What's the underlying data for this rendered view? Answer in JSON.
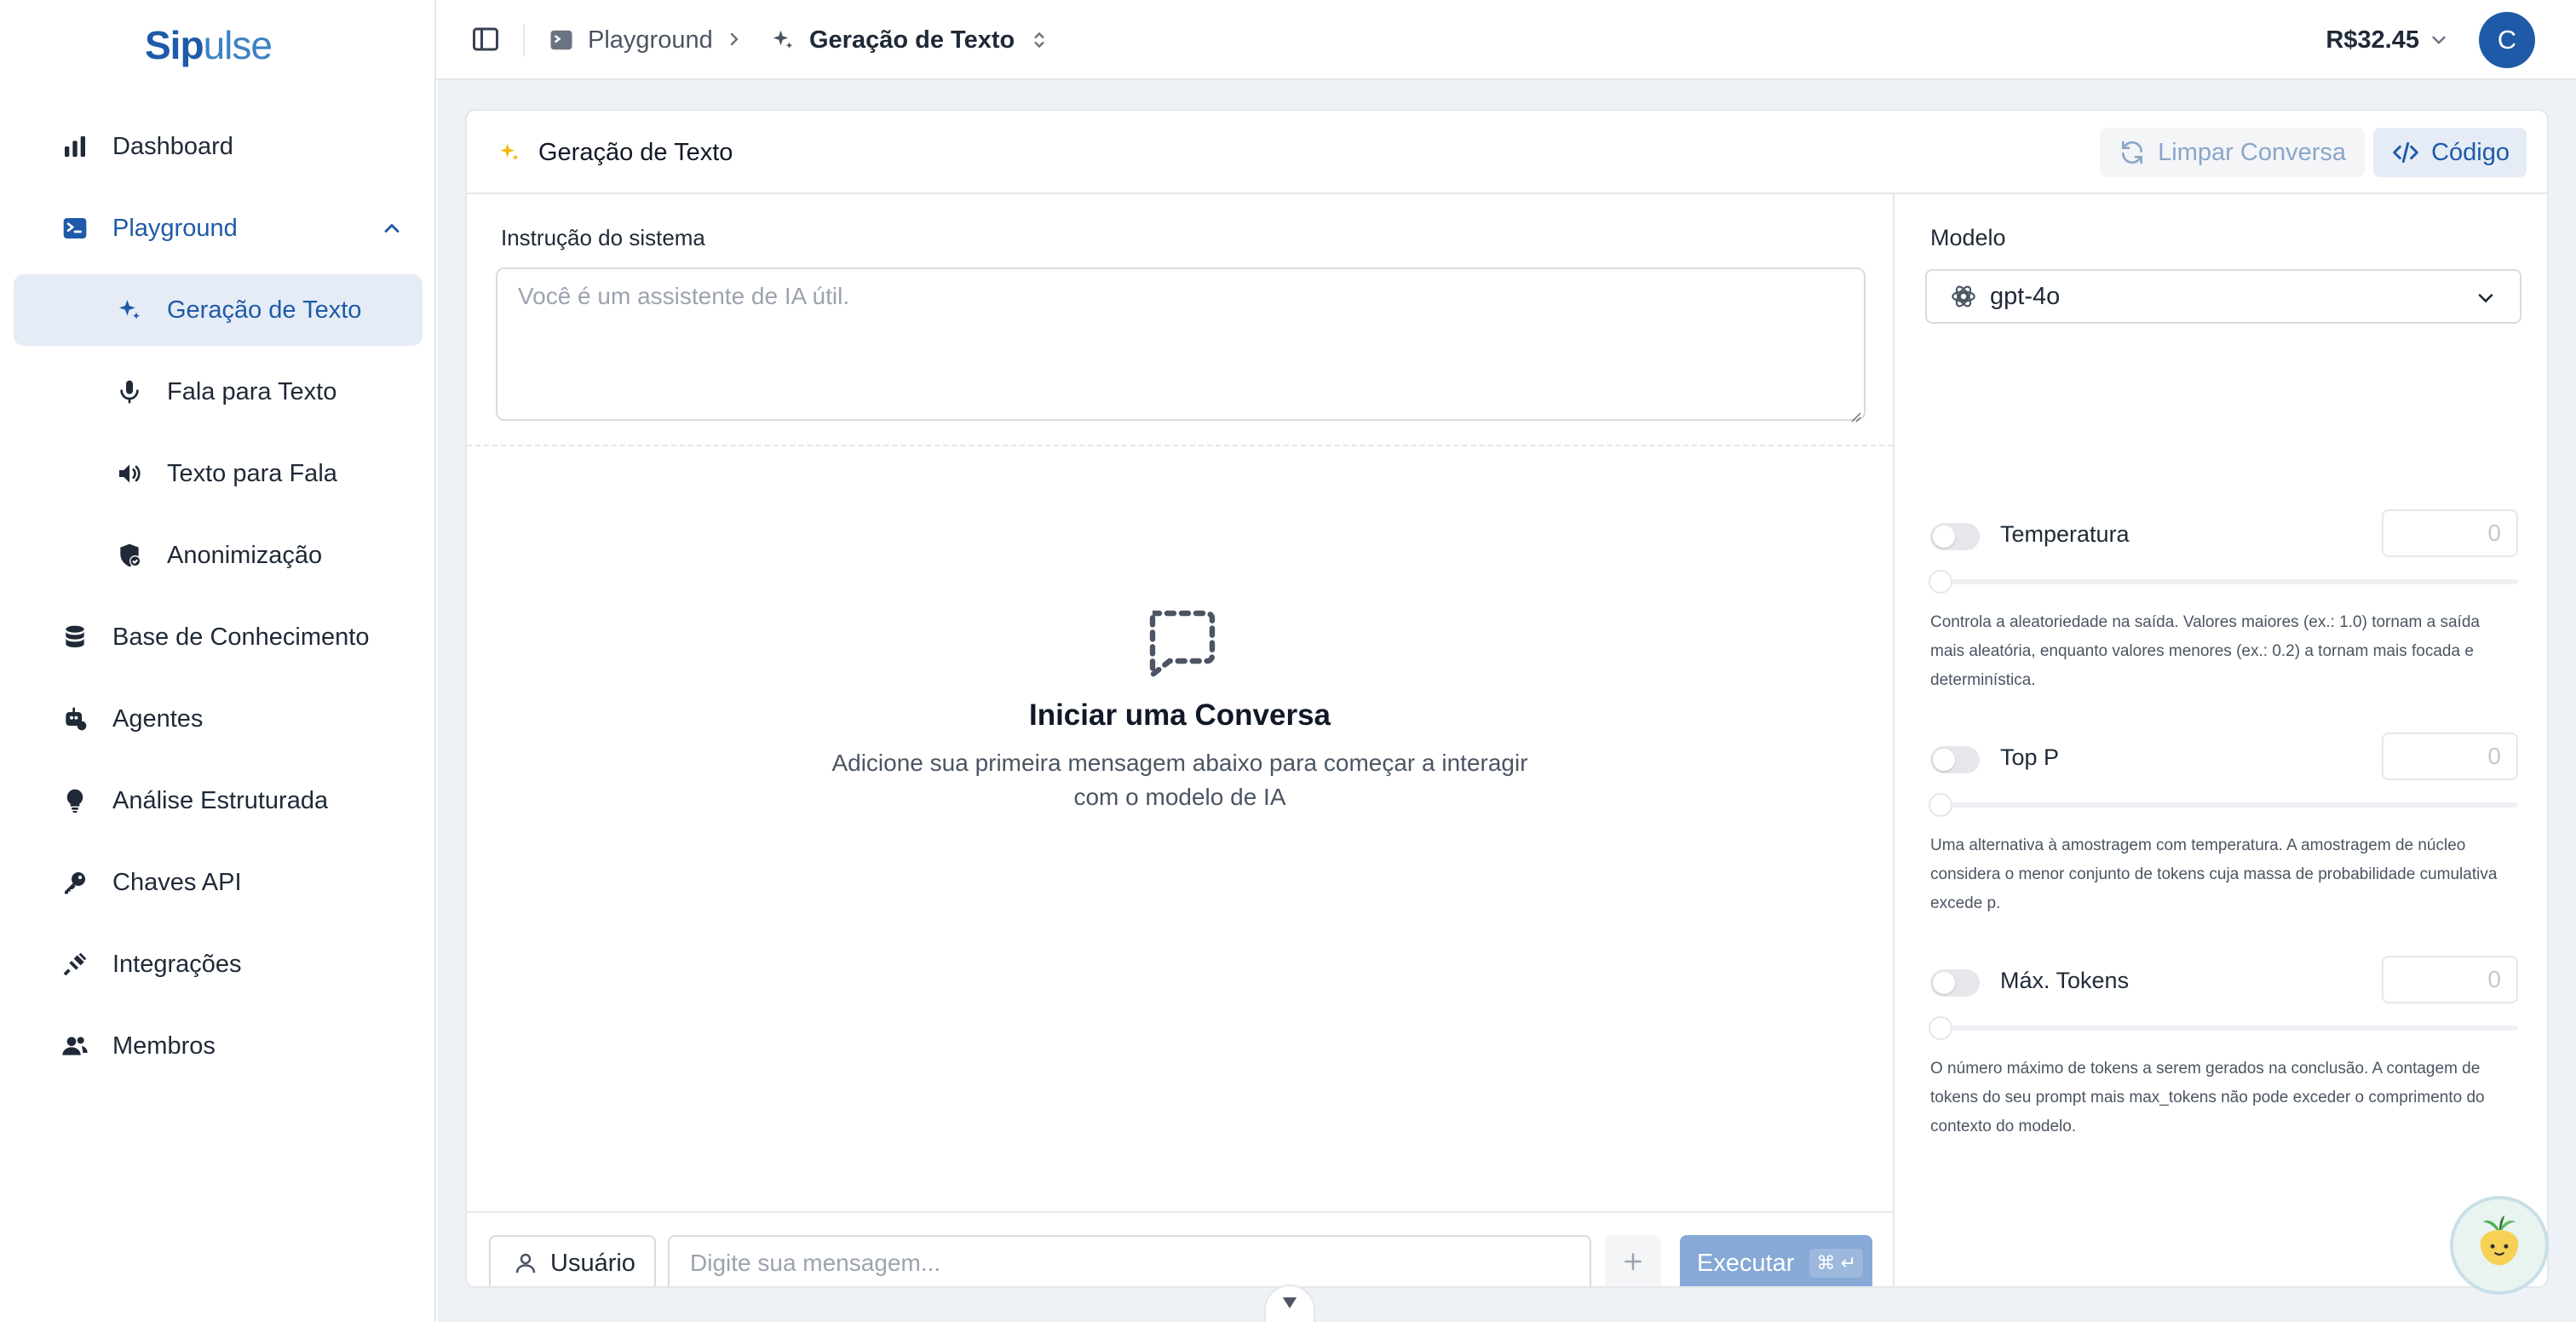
{
  "brand": {
    "logo_part1": "Sip",
    "logo_part2": "ulse"
  },
  "sidebar": {
    "items": [
      {
        "label": "Dashboard",
        "icon": "bar-chart-icon"
      },
      {
        "label": "Playground",
        "icon": "terminal-icon"
      },
      {
        "label": "Geração de Texto",
        "icon": "sparkles-icon"
      },
      {
        "label": "Fala para Texto",
        "icon": "microphone-icon"
      },
      {
        "label": "Texto para Fala",
        "icon": "speaker-icon"
      },
      {
        "label": "Anonimização",
        "icon": "shield-check-icon"
      },
      {
        "label": "Base de Conhecimento",
        "icon": "database-icon"
      },
      {
        "label": "Agentes",
        "icon": "robot-icon"
      },
      {
        "label": "Análise Estruturada",
        "icon": "lightbulb-icon"
      },
      {
        "label": "Chaves API",
        "icon": "key-icon"
      },
      {
        "label": "Integrações",
        "icon": "plug-icon"
      },
      {
        "label": "Membros",
        "icon": "users-icon"
      }
    ]
  },
  "topbar": {
    "breadcrumb_parent": "Playground",
    "breadcrumb_current": "Geração de Texto",
    "balance": "R$32.45",
    "avatar_initial": "C"
  },
  "card": {
    "title": "Geração de Texto",
    "clear_label": "Limpar Conversa",
    "code_label": "Código"
  },
  "system": {
    "label": "Instrução do sistema",
    "placeholder": "Você é um assistente de IA útil."
  },
  "empty_state": {
    "title": "Iniciar uma Conversa",
    "subtitle": "Adicione sua primeira mensagem abaixo para começar a interagir com o modelo de IA"
  },
  "composer": {
    "role": "Usuário",
    "placeholder": "Digite sua mensagem...",
    "run_label": "Executar",
    "shortcut": "⌘ ↵"
  },
  "settings": {
    "model_label": "Modelo",
    "model_value": "gpt-4o",
    "params": [
      {
        "label": "Temperatura",
        "value": "0",
        "enabled": false,
        "description": "Controla a aleatoriedade na saída. Valores maiores (ex.: 1.0) tornam a saída mais aleatória, enquanto valores menores (ex.: 0.2) a tornam mais focada e determinística."
      },
      {
        "label": "Top P",
        "value": "0",
        "enabled": false,
        "description": "Uma alternativa à amostragem com temperatura. A amostragem de núcleo considera o menor conjunto de tokens cuja massa de probabilidade cumulativa excede p."
      },
      {
        "label": "Máx. Tokens",
        "value": "0",
        "enabled": false,
        "description": "O número máximo de tokens a serem gerados na conclusão. A contagem de tokens do seu prompt mais max_tokens não pode exceder o comprimento do contexto do modelo."
      }
    ]
  },
  "colors": {
    "primary": "#1e5aa8",
    "active_bg": "#e5ecf6",
    "content_bg": "#eef1f5",
    "run_button": "#86a9d6",
    "sparkle": "#f5b90b"
  }
}
